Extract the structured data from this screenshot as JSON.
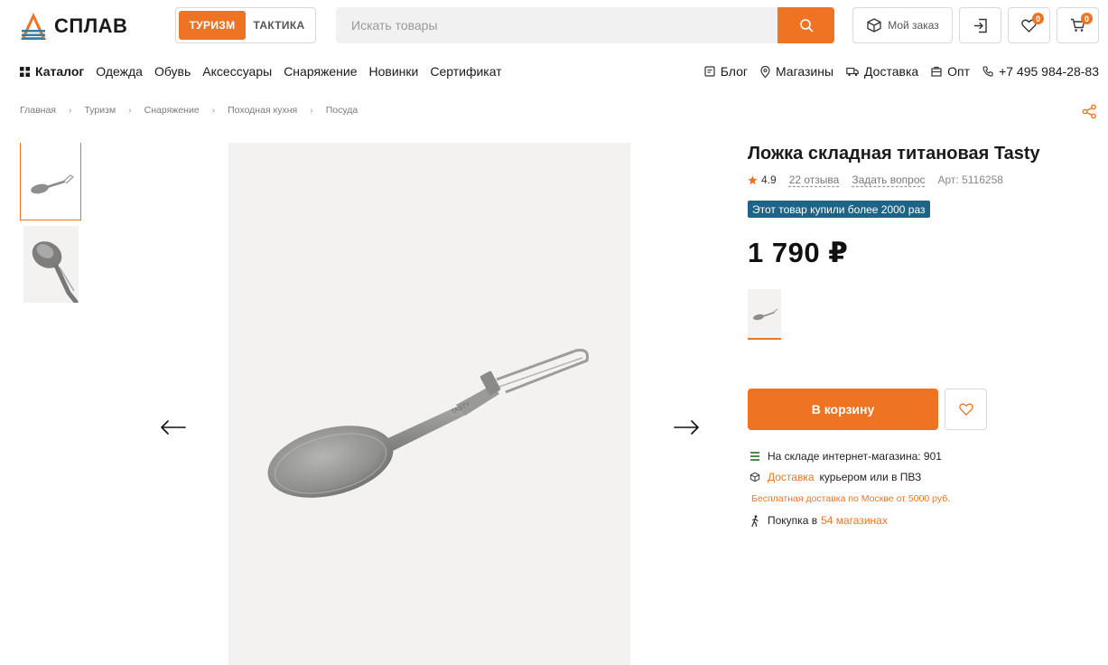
{
  "brand": {
    "name": "СПЛАВ",
    "accent": "#ee7423"
  },
  "modes": {
    "active": "ТУРИЗМ",
    "inactive": "ТАКТИКА"
  },
  "search": {
    "placeholder": "Искать товары"
  },
  "header": {
    "order_label": "Мой заказ",
    "favorites_count": "0",
    "cart_count": "0"
  },
  "nav": {
    "catalog": "Каталог",
    "items": [
      "Одежда",
      "Обувь",
      "Аксессуары",
      "Снаряжение",
      "Новинки",
      "Сертификат"
    ],
    "right": {
      "blog": "Блог",
      "stores": "Магазины",
      "delivery": "Доставка",
      "wholesale": "Опт",
      "phone": "+7 495 984-28-83"
    }
  },
  "breadcrumbs": [
    "Главная",
    "Туризм",
    "Снаряжение",
    "Походная кухня",
    "Посуда"
  ],
  "product": {
    "title": "Ложка складная титановая Tasty",
    "rating": "4.9",
    "reviews": "22 отзыва",
    "ask": "Задать вопрос",
    "article": "Арт: 5116258",
    "promo": "Этот товар купили более 2000 раз",
    "price": "1 790 ₽",
    "add_to_cart": "В корзину",
    "stock": "На складе интернет-магазина: 901",
    "delivery_link": "Доставка",
    "delivery_text": "курьером или в ПВЗ",
    "free_delivery": "Бесплатная доставка по Москве от 5000 руб.",
    "stores_text": "Покупка в",
    "stores_link": "54 магазинах"
  },
  "colors": {
    "accent": "#ee7423",
    "promo_bg": "#1d6486"
  }
}
